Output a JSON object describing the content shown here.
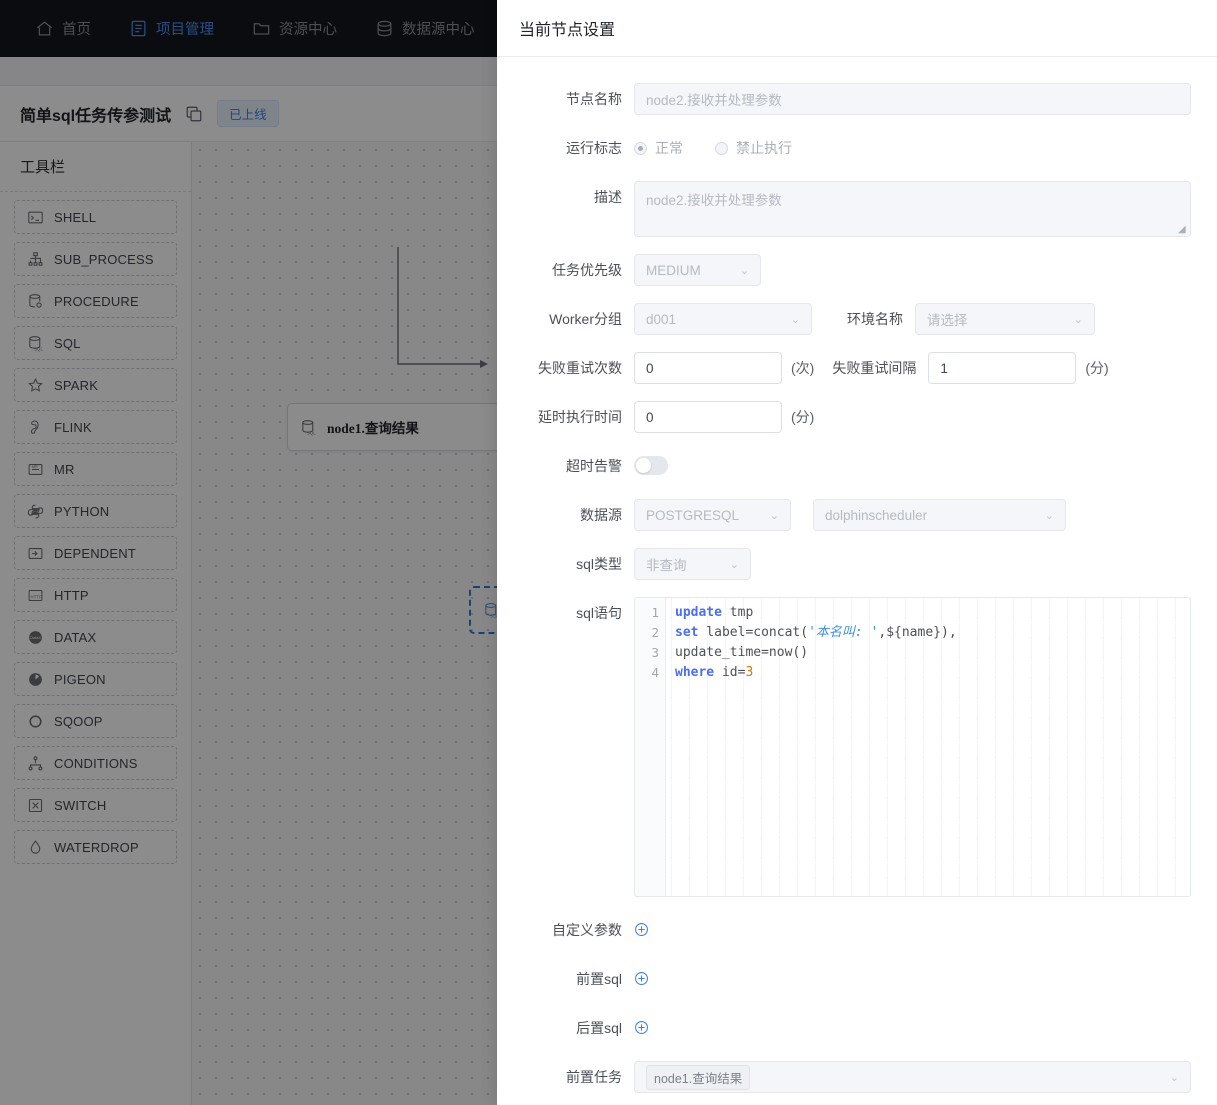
{
  "topnav": {
    "items": [
      {
        "label": "首页",
        "icon": "home-icon",
        "active": false
      },
      {
        "label": "项目管理",
        "icon": "project-icon",
        "active": true
      },
      {
        "label": "资源中心",
        "icon": "folder-icon",
        "active": false
      },
      {
        "label": "数据源中心",
        "icon": "database-icon",
        "active": false
      },
      {
        "label": "",
        "icon": "monitor-icon",
        "active": false
      }
    ]
  },
  "project": {
    "title": "简单sql任务传参测试",
    "copy_icon": "copy-icon",
    "status_badge": "已上线"
  },
  "toolbar": {
    "title": "工具栏",
    "items": [
      {
        "label": "SHELL",
        "icon": "terminal-icon"
      },
      {
        "label": "SUB_PROCESS",
        "icon": "sitemap-icon"
      },
      {
        "label": "PROCEDURE",
        "icon": "database-gear-icon"
      },
      {
        "label": "SQL",
        "icon": "database-sql-icon"
      },
      {
        "label": "SPARK",
        "icon": "star-icon"
      },
      {
        "label": "FLINK",
        "icon": "squirrel-icon"
      },
      {
        "label": "MR",
        "icon": "mr-icon"
      },
      {
        "label": "PYTHON",
        "icon": "python-icon"
      },
      {
        "label": "DEPENDENT",
        "icon": "dependent-icon"
      },
      {
        "label": "HTTP",
        "icon": "http-icon"
      },
      {
        "label": "DATAX",
        "icon": "datax-icon"
      },
      {
        "label": "PIGEON",
        "icon": "pigeon-icon"
      },
      {
        "label": "SQOOP",
        "icon": "circle-icon"
      },
      {
        "label": "CONDITIONS",
        "icon": "conditions-icon"
      },
      {
        "label": "SWITCH",
        "icon": "switch-icon"
      },
      {
        "label": "WATERDROP",
        "icon": "drop-icon"
      }
    ]
  },
  "canvas": {
    "nodes": [
      {
        "label": "node1.查询结果",
        "icon": "database-sql-icon",
        "selected": false
      },
      {
        "label": "",
        "icon": "database-sql-icon",
        "selected": true
      }
    ]
  },
  "panel": {
    "title": "当前节点设置",
    "node_name": {
      "label": "节点名称",
      "placeholder": "node2.接收并处理参数"
    },
    "run_flag": {
      "label": "运行标志",
      "options": [
        {
          "label": "正常",
          "selected": true
        },
        {
          "label": "禁止执行",
          "selected": false
        }
      ]
    },
    "description": {
      "label": "描述",
      "placeholder": "node2.接收并处理参数"
    },
    "priority": {
      "label": "任务优先级",
      "value": "MEDIUM"
    },
    "worker_group": {
      "label": "Worker分组",
      "value": "d001"
    },
    "environment": {
      "label": "环境名称",
      "value": "请选择"
    },
    "retry_times": {
      "label": "失败重试次数",
      "value": "0",
      "unit": "(次)"
    },
    "retry_interval": {
      "label": "失败重试间隔",
      "value": "1",
      "unit": "(分)"
    },
    "delay_time": {
      "label": "延时执行时间",
      "value": "0",
      "unit": "(分)"
    },
    "timeout_alarm": {
      "label": "超时告警",
      "enabled": false
    },
    "datasource": {
      "label": "数据源",
      "type_value": "POSTGRESQL",
      "instance_value": "dolphinscheduler"
    },
    "sql_type": {
      "label": "sql类型",
      "value": "非查询"
    },
    "sql_statement": {
      "label": "sql语句",
      "lines": [
        {
          "no": "1",
          "tokens": [
            {
              "t": "update",
              "c": "kw"
            },
            {
              "t": " tmp",
              "c": ""
            }
          ]
        },
        {
          "no": "2",
          "tokens": [
            {
              "t": "set",
              "c": "kw"
            },
            {
              "t": " label=concat(",
              "c": ""
            },
            {
              "t": "'本名叫: '",
              "c": "str"
            },
            {
              "t": ",${name}),",
              "c": ""
            }
          ]
        },
        {
          "no": "3",
          "tokens": [
            {
              "t": "update_time=now()",
              "c": ""
            }
          ]
        },
        {
          "no": "4",
          "tokens": [
            {
              "t": "where",
              "c": "kw"
            },
            {
              "t": " id=",
              "c": ""
            },
            {
              "t": "3",
              "c": "num"
            }
          ]
        }
      ],
      "plain": "update tmp\nset label=concat('本名叫: ',${name}),\nupdate_time=now()\nwhere id=3"
    },
    "custom_params": {
      "label": "自定义参数",
      "add_icon": "plus-circle-icon"
    },
    "pre_sql": {
      "label": "前置sql",
      "add_icon": "plus-circle-icon"
    },
    "post_sql": {
      "label": "后置sql",
      "add_icon": "plus-circle-icon"
    },
    "pre_tasks": {
      "label": "前置任务",
      "value": "node1.查询结果"
    }
  },
  "colors": {
    "accent": "#4a8ff0",
    "nav_bg": "#14161c",
    "badge_text": "#3a80e8",
    "keyword": "#4c6ef0",
    "string": "#3f8fe0",
    "number": "#d9730d"
  }
}
